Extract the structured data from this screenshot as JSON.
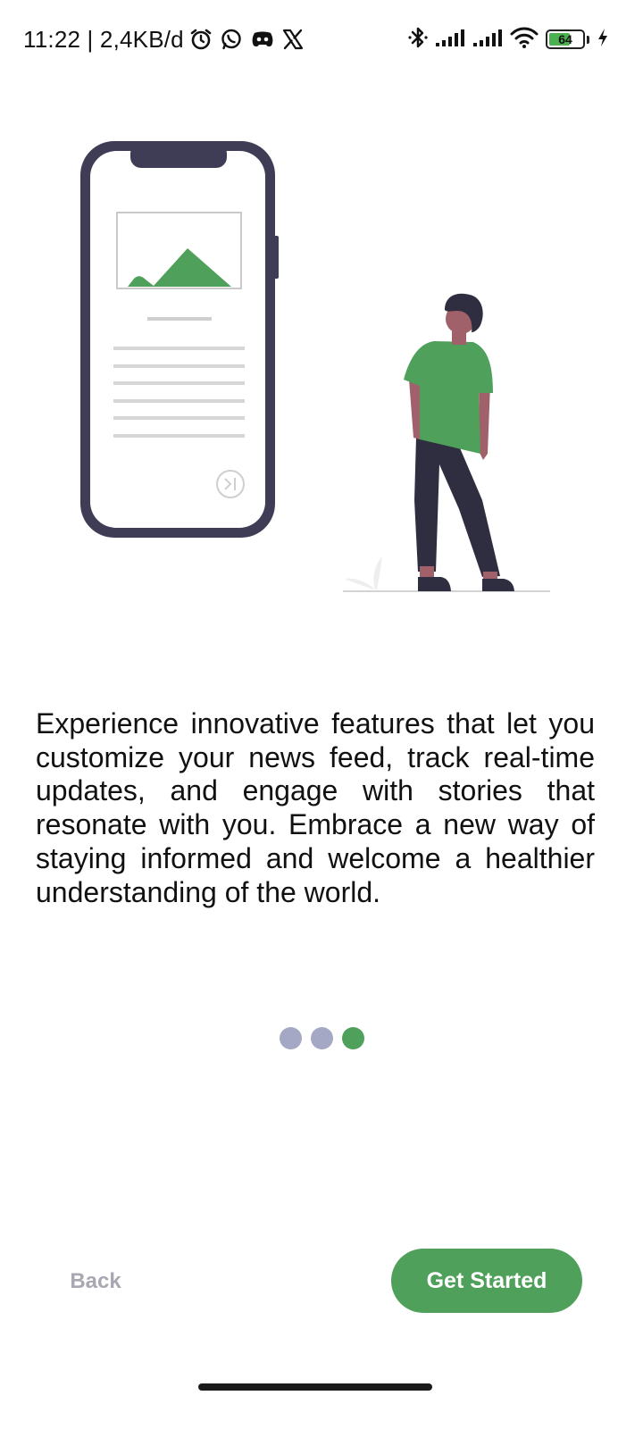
{
  "status_bar": {
    "time": "11:22 | 2,4KB/d",
    "left_icons": [
      "alarm-icon",
      "whatsapp-icon",
      "discord-icon",
      "x-icon"
    ],
    "right_icons": [
      "bluetooth-icon",
      "signal-icon",
      "signal-icon",
      "wifi-icon"
    ],
    "battery_level": "64",
    "battery_percent": 64
  },
  "onboarding": {
    "description": "Experience innovative features that let you customize your news feed, track real-time updates, and engage with stories that resonate with you. Embrace a new way of staying informed and welcome a healthier understanding of the world.",
    "pager": {
      "total": 3,
      "active_index": 2
    }
  },
  "actions": {
    "back_label": "Back",
    "get_started_label": "Get Started"
  },
  "colors": {
    "accent": "#4fa05a",
    "dot_inactive": "#a5a8c4",
    "phone_frame": "#3f3d56",
    "back_text": "#a8a8b2"
  }
}
